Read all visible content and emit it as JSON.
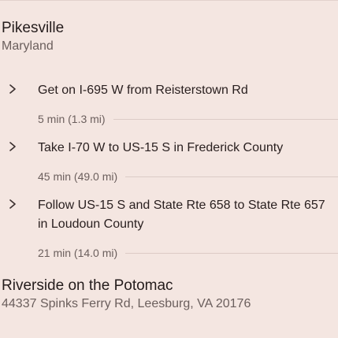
{
  "origin": {
    "name": "Pikesville",
    "region": "Maryland"
  },
  "steps": [
    {
      "icon": "chevron-right-icon",
      "instruction": "Get on I-695 W from Reisterstown Rd",
      "duration": "5 min (1.3 mi)"
    },
    {
      "icon": "chevron-right-icon",
      "instruction": "Take I-70 W to US-15 S in Frederick County",
      "duration": "45 min (49.0 mi)"
    },
    {
      "icon": "chevron-right-icon",
      "instruction": "Follow US-15 S and State Rte 658 to State Rte 657 in Loudoun County",
      "duration": "21 min (14.0 mi)"
    }
  ],
  "destination": {
    "name": "Riverside on the Potomac",
    "address": "44337 Spinks Ferry Rd, Leesburg, VA 20176"
  },
  "colors": {
    "background": "#f4e6e1",
    "primary_text": "#241c1c",
    "secondary_text": "#6b5f5d",
    "divider": "#dccbc6"
  }
}
